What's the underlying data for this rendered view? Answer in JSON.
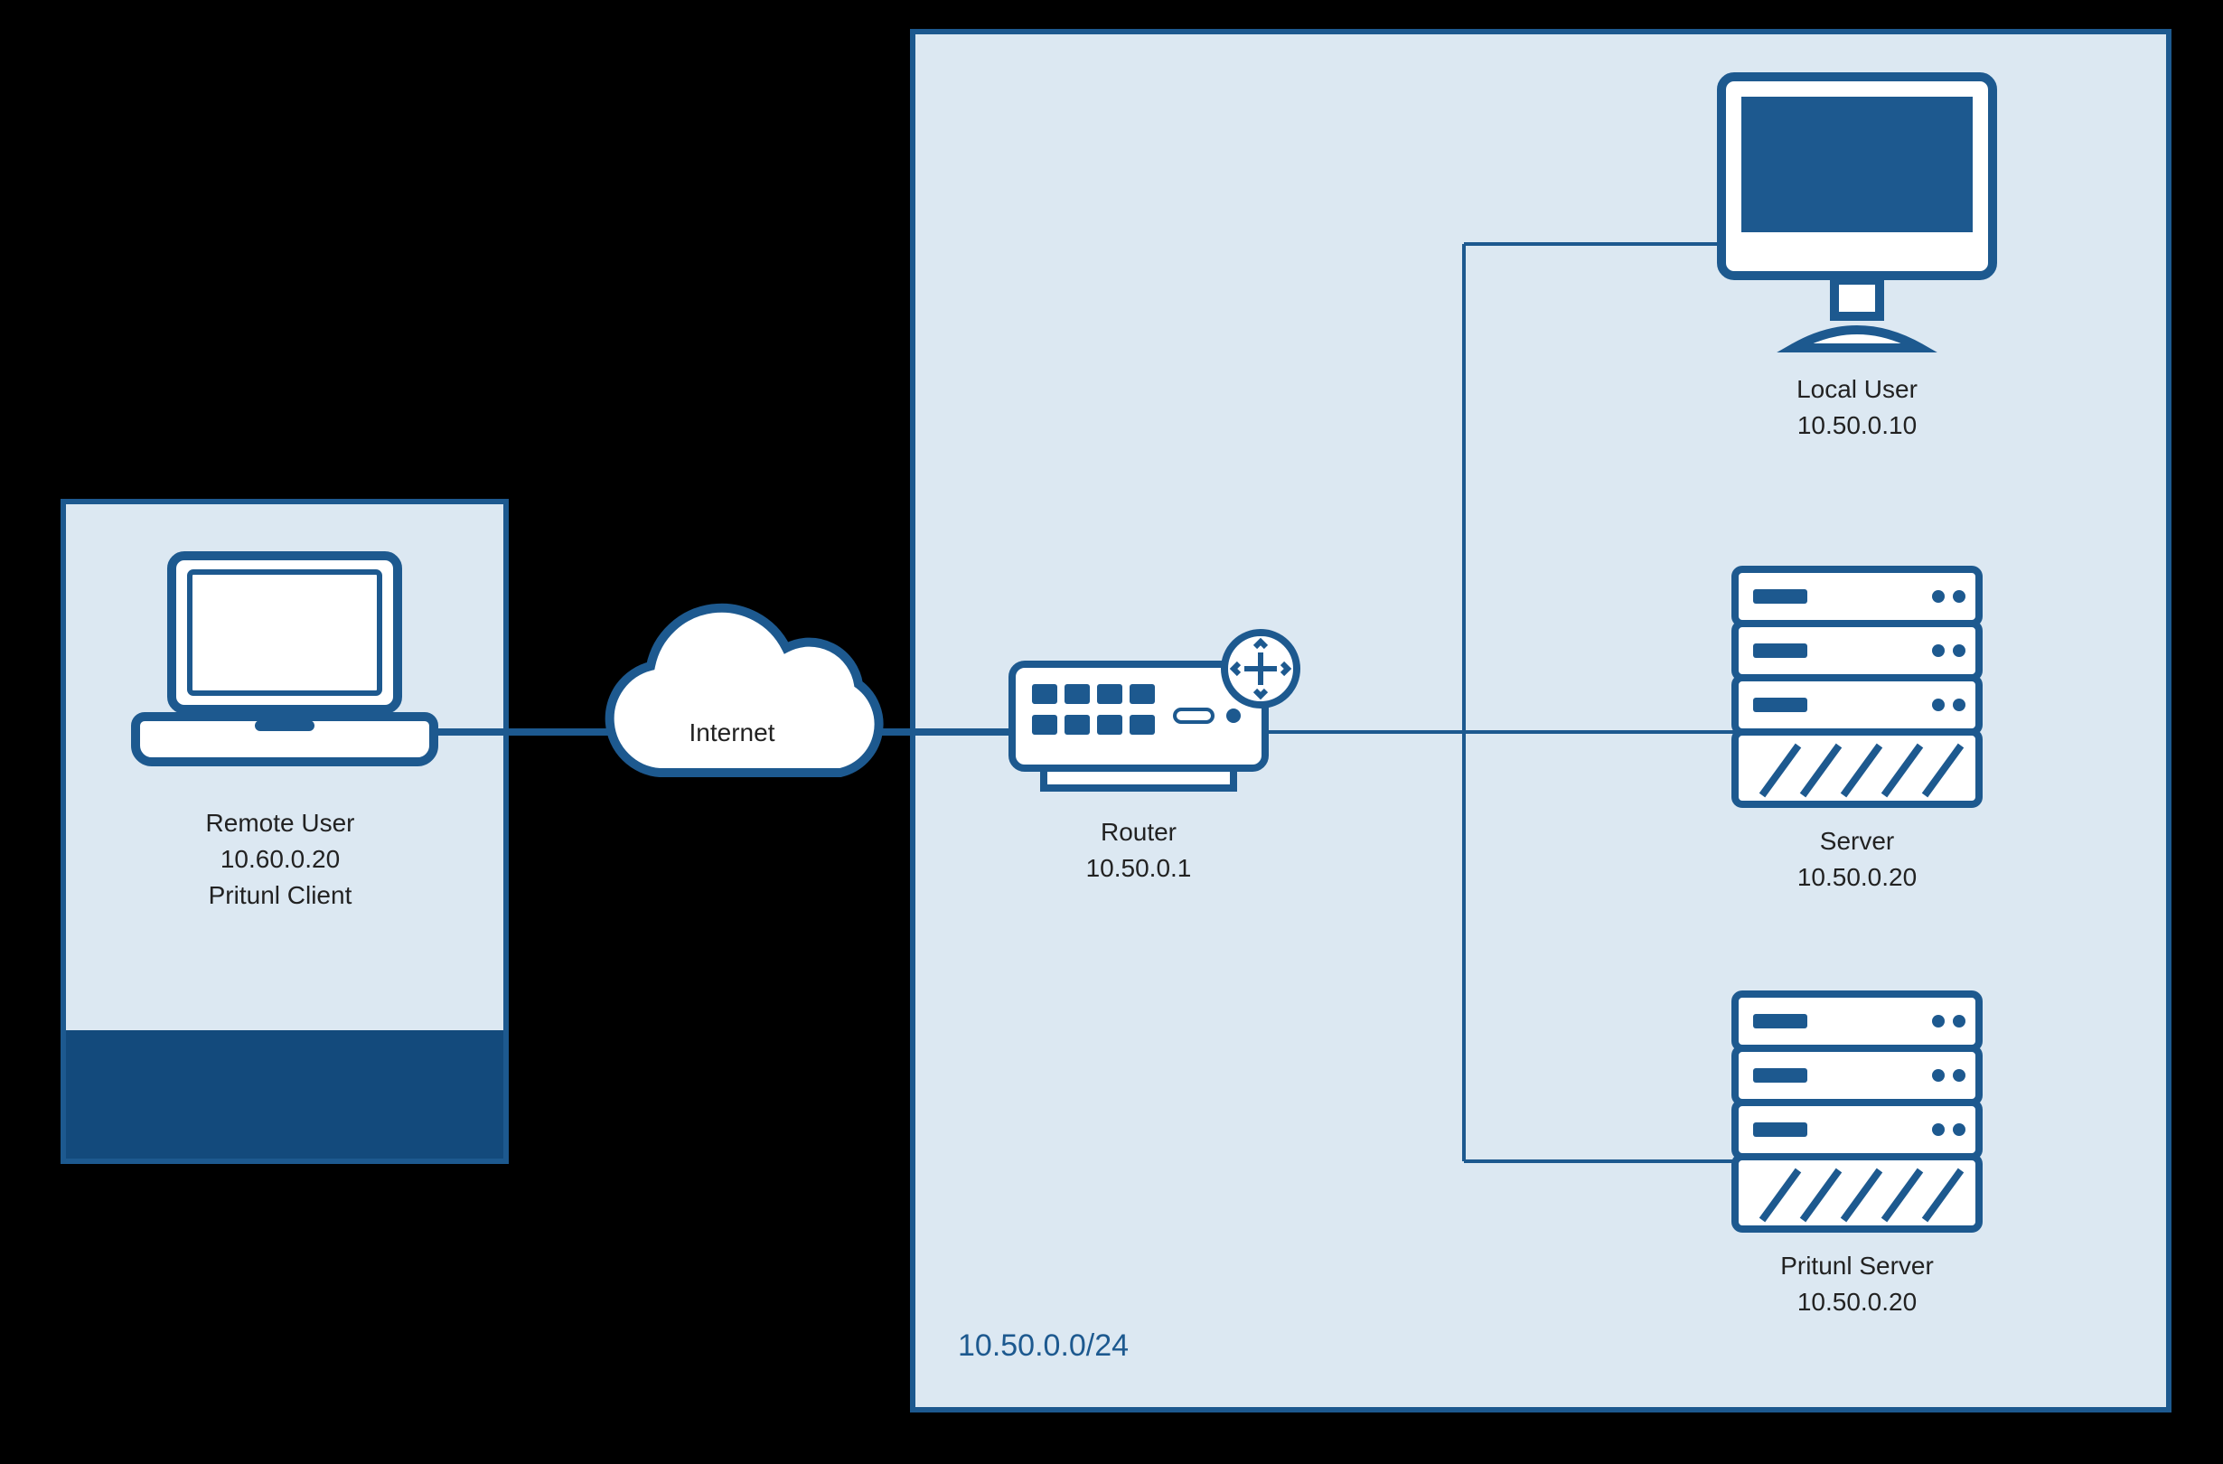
{
  "diagram": {
    "remote_user": {
      "title": "Remote User",
      "ip": "10.60.0.20",
      "role": "Pritunl Client"
    },
    "internet": {
      "label": "Internet"
    },
    "router": {
      "title": "Router",
      "ip": "10.50.0.1"
    },
    "local_user": {
      "title": "Local User",
      "ip": "10.50.0.10"
    },
    "server": {
      "title": "Server",
      "ip": "10.50.0.20"
    },
    "pritunl_server": {
      "title": "Pritunl Server",
      "ip": "10.50.0.20"
    },
    "subnet": {
      "cidr": "10.50.0.0/24"
    }
  },
  "colors": {
    "primary": "#1d598f",
    "panel": "#dce8f2",
    "panel_dark": "#134a7c"
  }
}
